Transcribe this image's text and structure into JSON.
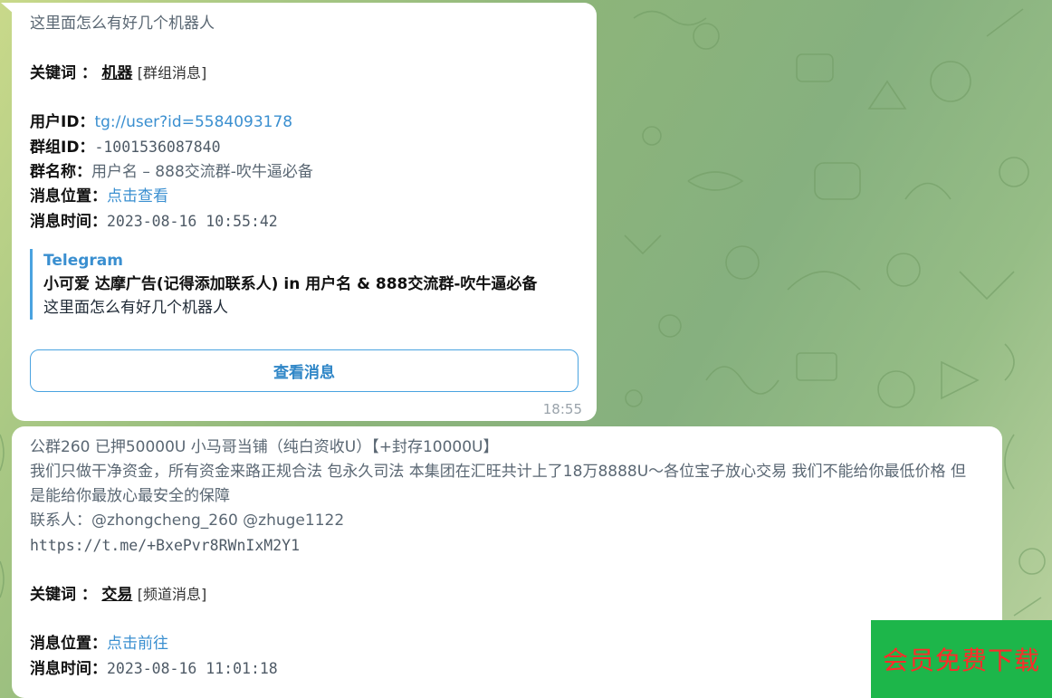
{
  "message1": {
    "text": "这里面怎么有好几个机器人",
    "keyword_label": "关键词 ：",
    "keyword_value": "机器",
    "keyword_type": "[群组消息]",
    "user_id_label": "用户ID：",
    "user_id_value": "tg://user?id=5584093178",
    "group_id_label": "群组ID：",
    "group_id_value": "-1001536087840",
    "group_name_label": "群名称：",
    "group_name_value": "用户名 – 888交流群-吹牛逼必备",
    "position_label": "消息位置：",
    "position_link": "点击查看",
    "time_label": "消息时间：",
    "time_value": "2023-08-16 10:55:42",
    "quote": {
      "source": "Telegram",
      "title": "小可爱 达摩广告(记得添加联系人) in 用户名 & 888交流群-吹牛逼必备",
      "body": "这里面怎么有好几个机器人"
    },
    "button_label": "查看消息",
    "timestamp": "18:55"
  },
  "message2": {
    "line1": "公群260 已押50000U 小马哥当铺（纯白资收U）【+封存10000U】",
    "line2": "我们只做干净资金，所有资金来路正规合法 包永久司法 本集团在汇旺共计上了18万8888U～各位宝子放心交易 我们不能给你最低价格 但是能给你最放心最安全的保障",
    "contacts": "联系人：@zhongcheng_260 @zhuge1122",
    "link": "https://t.me/+BxePvr8RWnIxM2Y1",
    "keyword_label": "关键词 ：",
    "keyword_value": "交易",
    "keyword_type": "[频道消息]",
    "position_label": "消息位置：",
    "position_link": "点击前往",
    "time_label": "消息时间：",
    "time_value": "2023-08-16 11:01:18"
  },
  "overlay": {
    "download_label": "会员免费下载"
  },
  "colors": {
    "link": "#3a8fd0",
    "button_border": "#4aa3e0",
    "badge_bg": "#1db64a",
    "badge_text": "#ff2a2a"
  }
}
